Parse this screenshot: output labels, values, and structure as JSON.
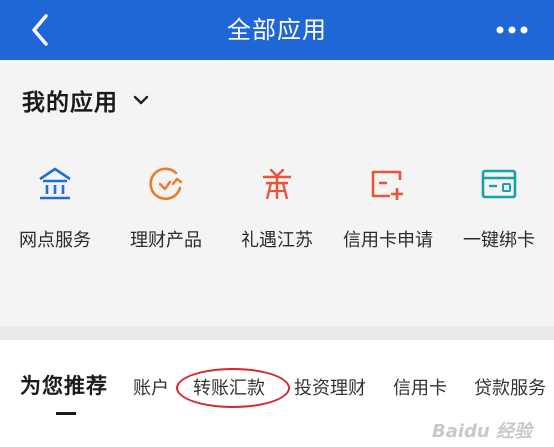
{
  "header": {
    "title": "全部应用",
    "back_icon": "chevron-left-icon",
    "more_icon": "more-horizontal-icon",
    "bar_color": "#1f67d6"
  },
  "my_apps": {
    "title": "我的应用",
    "toggle_icon": "chevron-down-icon",
    "items": [
      {
        "label": "网点服务",
        "icon": "bank-branch-icon",
        "color": "#1f6fd6"
      },
      {
        "label": "理财产品",
        "icon": "wealth-product-icon",
        "color": "#ef7b2a"
      },
      {
        "label": "礼遇江苏",
        "icon": "gift-icon",
        "color": "#e9553c"
      },
      {
        "label": "信用卡申请",
        "icon": "credit-card-apply-icon",
        "color": "#e9553c"
      },
      {
        "label": "一键绑卡",
        "icon": "card-bind-icon",
        "color": "#17a2a6"
      }
    ]
  },
  "recommend": {
    "title": "为您推荐",
    "tabs": [
      "账户",
      "转账汇款",
      "投资理财",
      "信用卡",
      "贷款服务"
    ]
  },
  "watermark": "Baidu 经验"
}
